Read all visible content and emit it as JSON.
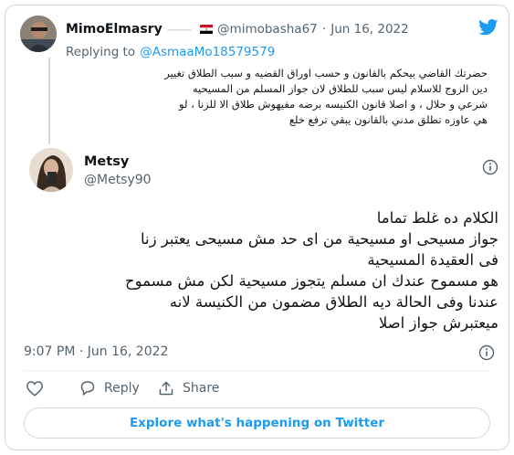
{
  "reply_tweet": {
    "author_name": "MimoElmasry",
    "author_handle": "@mimobasha67",
    "separator": "·",
    "date": "Jun 16, 2022",
    "replying_prefix": "Replying to",
    "replying_handle": "@AsmaaMo18579579",
    "lines": [
      "حضرتك القاضي بيحكم بالقانون و حسب اوراق القضيه و سبب الطلاق تغيير",
      "دين الزوج للاسلام ليس سبب للطلاق لان جواز المسلم من المسيحيه",
      "شرعي و حلال ، و اصلا قانون الكنيسه برضه مفيهوش طلاق الا للزنا ، لو",
      "هي عاوزه تطلق مدني بالقانون يبقي ترفع خلع"
    ]
  },
  "main_tweet": {
    "author_name": "Metsy",
    "author_handle": "@Metsy90",
    "lines": [
      "الكلام ده غلط تماما",
      "جواز مسيحى او مسيحية من اى حد مش مسيحى يعتبر زنا",
      "فى العقيدة المسيحية",
      "هو مسموح عندك ان مسلم يتجوز مسيحية لكن مش مسموح",
      "عندنا وفى الحالة ديه الطلاق مضمون من الكنيسة لانه",
      "ميعتبرش جواز اصلا"
    ],
    "timestamp": "9:07 PM · Jun 16, 2022"
  },
  "actions": {
    "reply_label": "Reply",
    "share_label": "Share"
  },
  "cta": {
    "label": "Explore what's happening on Twitter"
  },
  "icons": {
    "brand": "twitter-bird-icon",
    "info": "info-icon",
    "like": "heart-icon",
    "reply": "reply-bubble-icon",
    "share": "share-arrow-icon"
  },
  "colors": {
    "accent": "#1d9bf0",
    "muted": "#536471",
    "border": "#cfd9de"
  }
}
